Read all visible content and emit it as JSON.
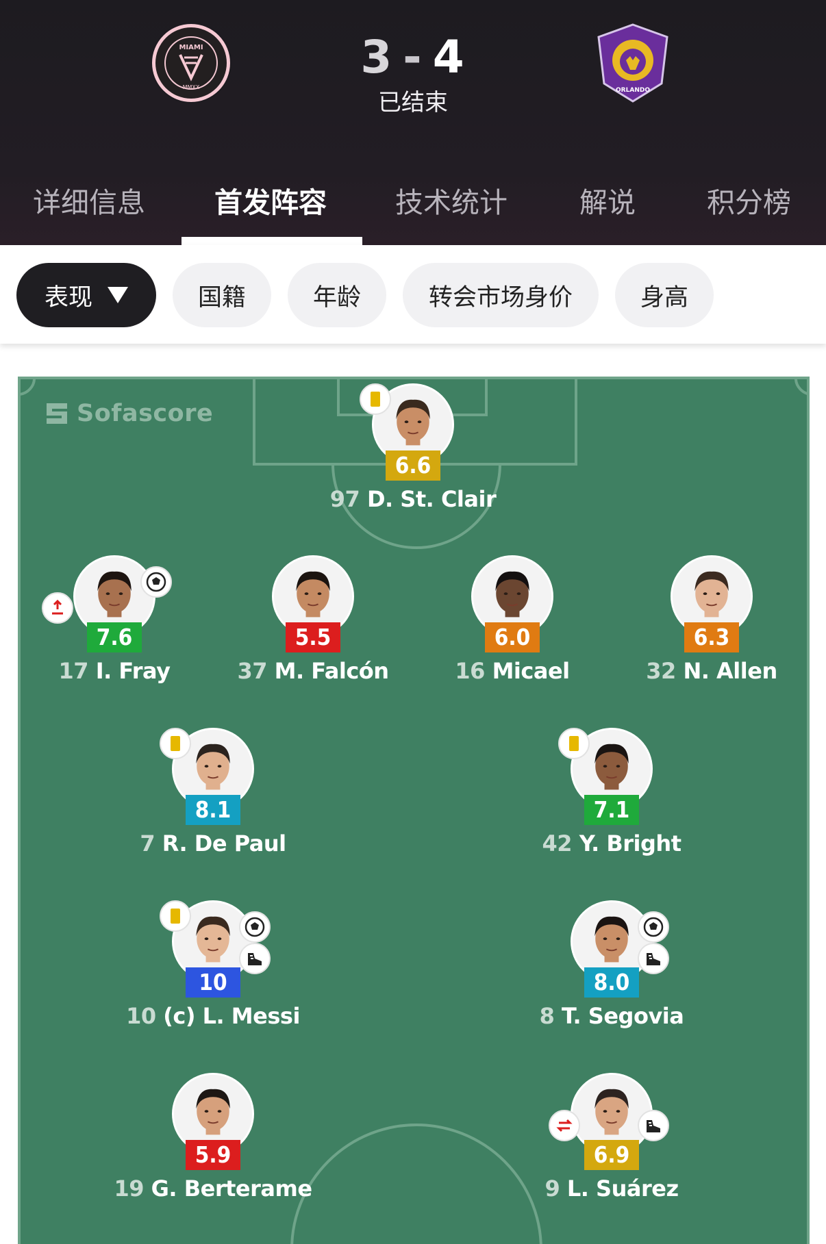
{
  "match": {
    "home_score": "3",
    "separator": "-",
    "away_score": "4",
    "status": "已结束",
    "home_team_logo_text": "MIAMI",
    "away_team_logo_text": "ORLANDO CITY"
  },
  "tabs": [
    {
      "label": "详细信息"
    },
    {
      "label": "首发阵容"
    },
    {
      "label": "技术统计"
    },
    {
      "label": "解说"
    },
    {
      "label": "积分榜"
    }
  ],
  "filters": [
    {
      "label": "表现"
    },
    {
      "label": "国籍"
    },
    {
      "label": "年龄"
    },
    {
      "label": "转会市场身价"
    },
    {
      "label": "身高"
    }
  ],
  "brand": {
    "name": "Sofascore"
  },
  "colors": {
    "header_bg": "#1d1b20",
    "pitch": "#3f8062",
    "rating_green": "#1faa3b",
    "rating_red": "#dc1e1e",
    "rating_orange": "#e07b12",
    "rating_yellow": "#d4a80f",
    "rating_teal": "#14a0c2",
    "rating_blue": "#2d55e0"
  },
  "players": [
    {
      "number": "97",
      "name": "D. St. Clair",
      "rating": "6.6",
      "rating_color": "#d4a80f",
      "badges": [
        "yellow-card"
      ]
    },
    {
      "number": "17",
      "name": "I. Fray",
      "rating": "7.6",
      "rating_color": "#1faa3b",
      "badges": [
        "goal",
        "substitution-out"
      ]
    },
    {
      "number": "37",
      "name": "M. Falcón",
      "rating": "5.5",
      "rating_color": "#dc1e1e",
      "badges": []
    },
    {
      "number": "16",
      "name": "Micael",
      "rating": "6.0",
      "rating_color": "#e07b12",
      "badges": []
    },
    {
      "number": "32",
      "name": "N. Allen",
      "rating": "6.3",
      "rating_color": "#e07b12",
      "badges": []
    },
    {
      "number": "7",
      "name": "R. De Paul",
      "rating": "8.1",
      "rating_color": "#14a0c2",
      "badges": [
        "yellow-card"
      ]
    },
    {
      "number": "42",
      "name": "Y. Bright",
      "rating": "7.1",
      "rating_color": "#1faa3b",
      "badges": [
        "yellow-card"
      ]
    },
    {
      "number": "10",
      "name": "(c) L. Messi",
      "rating": "10",
      "rating_color": "#2d55e0",
      "badges": [
        "yellow-card",
        "goal",
        "assist"
      ]
    },
    {
      "number": "8",
      "name": "T. Segovia",
      "rating": "8.0",
      "rating_color": "#14a0c2",
      "badges": [
        "goal",
        "assist"
      ]
    },
    {
      "number": "19",
      "name": "G. Berterame",
      "rating": "5.9",
      "rating_color": "#dc1e1e",
      "badges": []
    },
    {
      "number": "9",
      "name": "L. Suárez",
      "rating": "6.9",
      "rating_color": "#d4a80f",
      "badges": [
        "substitution",
        "assist"
      ]
    }
  ]
}
